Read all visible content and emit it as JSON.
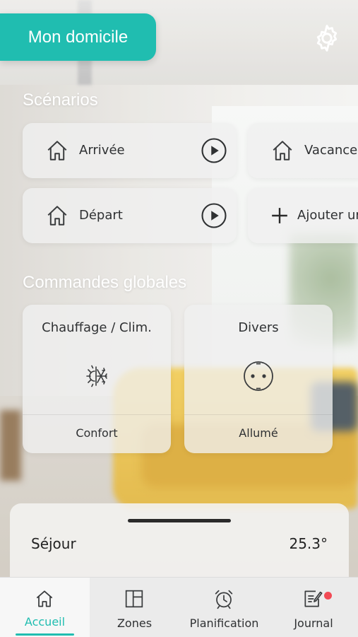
{
  "header": {
    "home_title": "Mon domicile",
    "settings_icon": "gear-icon"
  },
  "scenarios": {
    "title": "Scénarios",
    "items": [
      {
        "label": "Arrivée",
        "icon": "house-icon",
        "action_icon": "play-icon"
      },
      {
        "label": "Vacance",
        "icon": "house-icon"
      },
      {
        "label": "Départ",
        "icon": "house-icon",
        "action_icon": "play-icon"
      },
      {
        "label": "Ajouter ur",
        "icon": "plus-icon"
      }
    ]
  },
  "global_commands": {
    "title": "Commandes globales",
    "items": [
      {
        "title": "Chauffage / Clim.",
        "icon": "heat-cool-icon",
        "state": "Confort"
      },
      {
        "title": "Divers",
        "icon": "socket-icon",
        "state": "Allumé"
      }
    ]
  },
  "room_sheet": {
    "room": "Séjour",
    "temperature": "25.3°"
  },
  "tabs": [
    {
      "label": "Accueil",
      "icon": "home-icon",
      "active": true
    },
    {
      "label": "Zones",
      "icon": "zones-icon"
    },
    {
      "label": "Planification",
      "icon": "alarm-clock-icon"
    },
    {
      "label": "Journal",
      "icon": "journal-icon",
      "badge": true
    }
  ],
  "colors": {
    "accent": "#20bdb0",
    "badge": "#f24a55"
  }
}
